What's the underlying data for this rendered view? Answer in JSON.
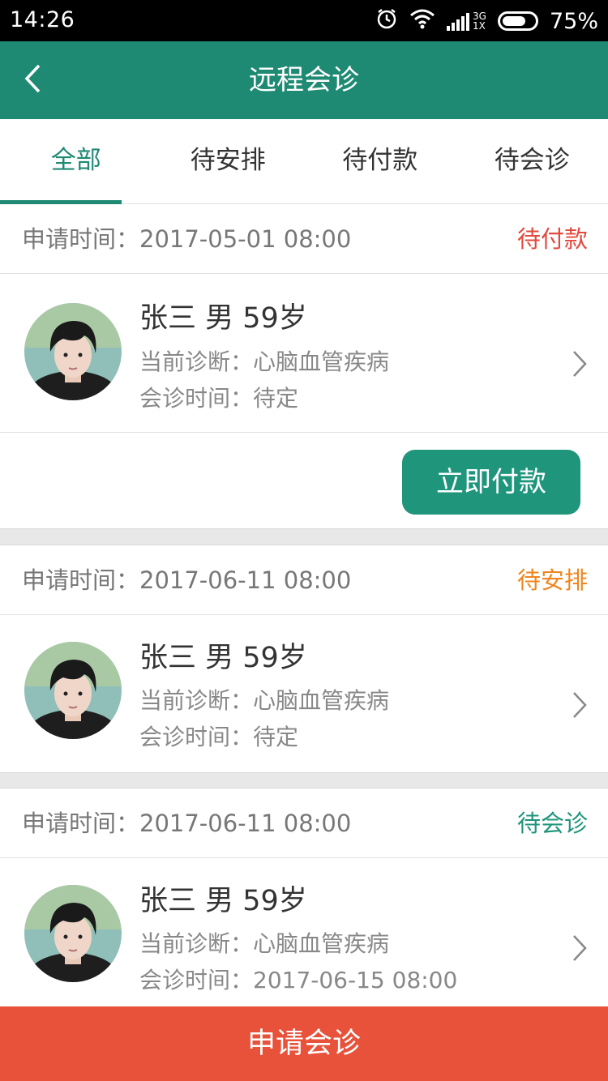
{
  "status_bar": {
    "time": "14:26",
    "network_top": "3G",
    "network_bottom": "1X",
    "battery": "75%",
    "battery_level": 0.75
  },
  "header": {
    "title": "远程会诊",
    "back_icon": "chevron-left-icon"
  },
  "tabs": [
    {
      "label": "全部",
      "active": true
    },
    {
      "label": "待安排",
      "active": false
    },
    {
      "label": "待付款",
      "active": false
    },
    {
      "label": "待会诊",
      "active": false
    }
  ],
  "colors": {
    "primary": "#1f8a73",
    "danger": "#e8513a",
    "warning": "#f0861f",
    "red_status": "#e2493c",
    "teal_status": "#1f957c"
  },
  "records": [
    {
      "apply_time": "申请时间：2017-05-01 08:00",
      "status": "待付款",
      "status_color": "#e2493c",
      "name_line": "张三 男 59岁",
      "diagnosis": "当前诊断：心脑血管疾病",
      "consult_time": "会诊时间：待定",
      "action": "立即付款"
    },
    {
      "apply_time": "申请时间：2017-06-11 08:00",
      "status": "待安排",
      "status_color": "#f0861f",
      "name_line": "张三 男 59岁",
      "diagnosis": "当前诊断：心脑血管疾病",
      "consult_time": "会诊时间：待定"
    },
    {
      "apply_time": "申请时间：2017-06-11 08:00",
      "status": "待会诊",
      "status_color": "#1f957c",
      "name_line": "张三 男 59岁",
      "diagnosis": "当前诊断：心脑血管疾病",
      "consult_time": "会诊时间：2017-06-15 08:00"
    }
  ],
  "footer": {
    "apply_label": "申请会诊"
  }
}
